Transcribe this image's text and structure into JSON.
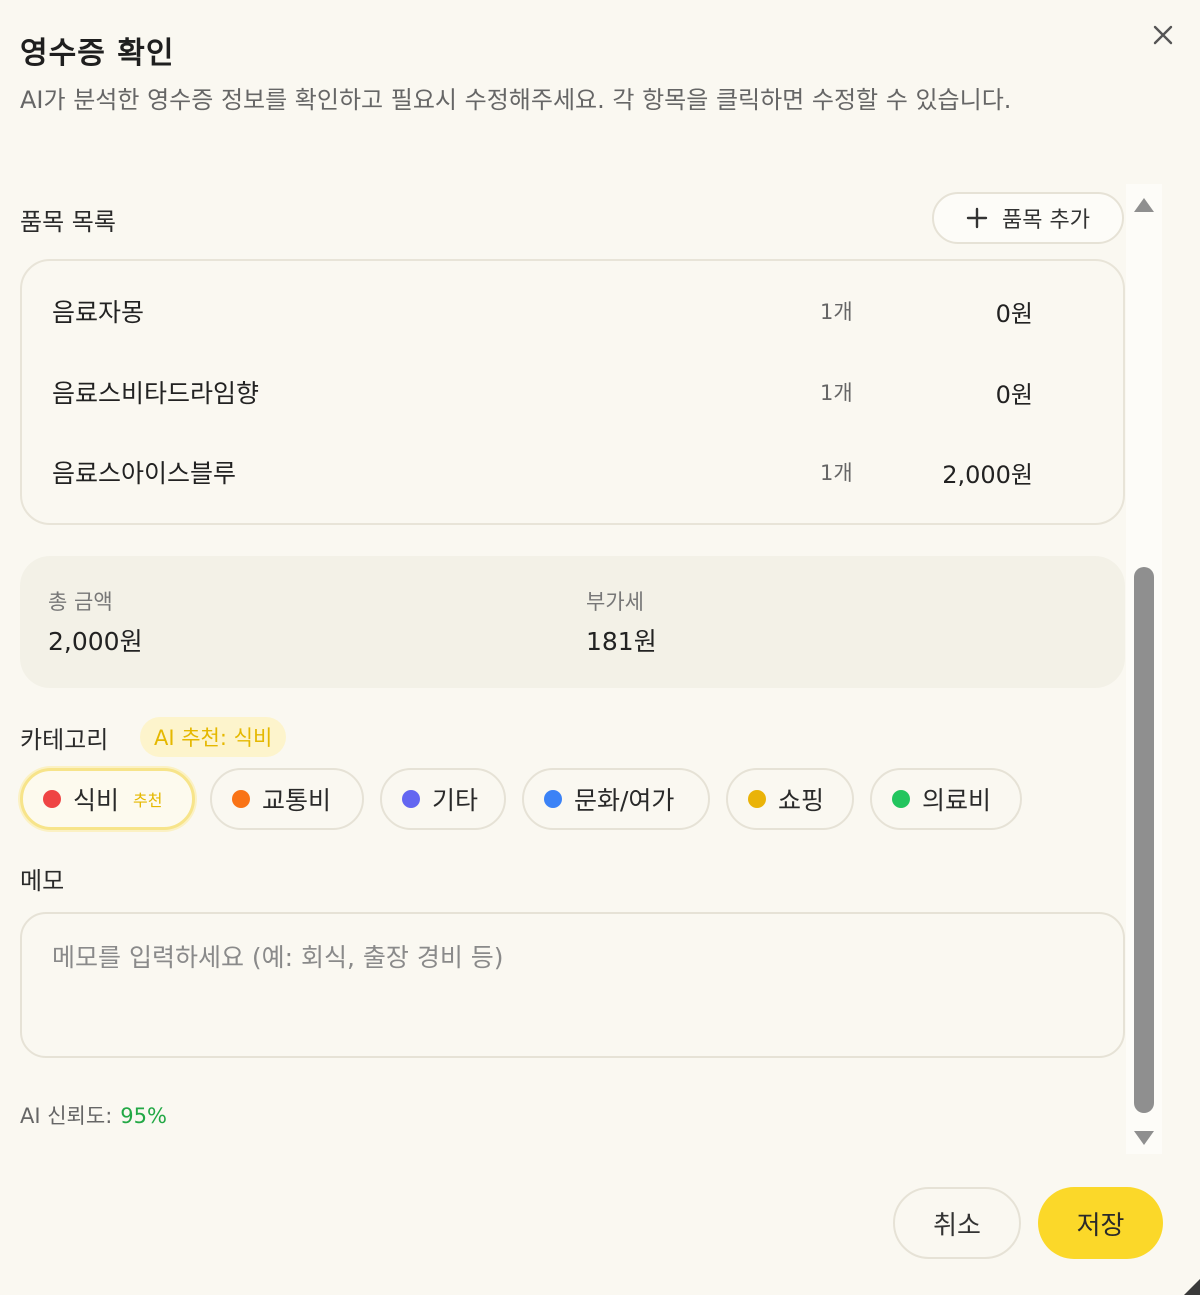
{
  "dialog": {
    "title": "영수증 확인",
    "description": "AI가 분석한 영수증 정보를 확인하고 필요시 수정해주세요. 각 항목을 클릭하면 수정할 수 있습니다.",
    "close_icon": "close-icon"
  },
  "items_section": {
    "label": "품목 목록",
    "add_button_label": "품목 추가",
    "add_icon": "plus-icon",
    "items": [
      {
        "name": "음료자몽",
        "qty": "1개",
        "price": "0원"
      },
      {
        "name": "음료스비타드라임향",
        "qty": "1개",
        "price": "0원"
      },
      {
        "name": "음료스아이스블루",
        "qty": "1개",
        "price": "2,000원"
      }
    ]
  },
  "totals": {
    "total_label": "총 금액",
    "total_value": "2,000원",
    "vat_label": "부가세",
    "vat_value": "181원"
  },
  "category": {
    "label": "카테고리",
    "ai_recommendation": "AI 추천: 식비",
    "recommended_tag": "추천",
    "options": [
      {
        "label": "식비",
        "color": "#ef4444",
        "selected": true
      },
      {
        "label": "교통비",
        "color": "#f97316",
        "selected": false
      },
      {
        "label": "기타",
        "color": "#6366f1",
        "selected": false
      },
      {
        "label": "문화/여가",
        "color": "#3b82f6",
        "selected": false
      },
      {
        "label": "쇼핑",
        "color": "#eab308",
        "selected": false
      },
      {
        "label": "의료비",
        "color": "#22c55e",
        "selected": false
      }
    ]
  },
  "memo": {
    "label": "메모",
    "value": "",
    "placeholder": "메모를 입력하세요 (예: 회식, 출장 경비 등)"
  },
  "confidence": {
    "label": "AI 신뢰도:",
    "value": "95%",
    "color": "#22a845"
  },
  "footer": {
    "cancel_label": "취소",
    "save_label": "저장",
    "save_color": "#fbd829"
  }
}
